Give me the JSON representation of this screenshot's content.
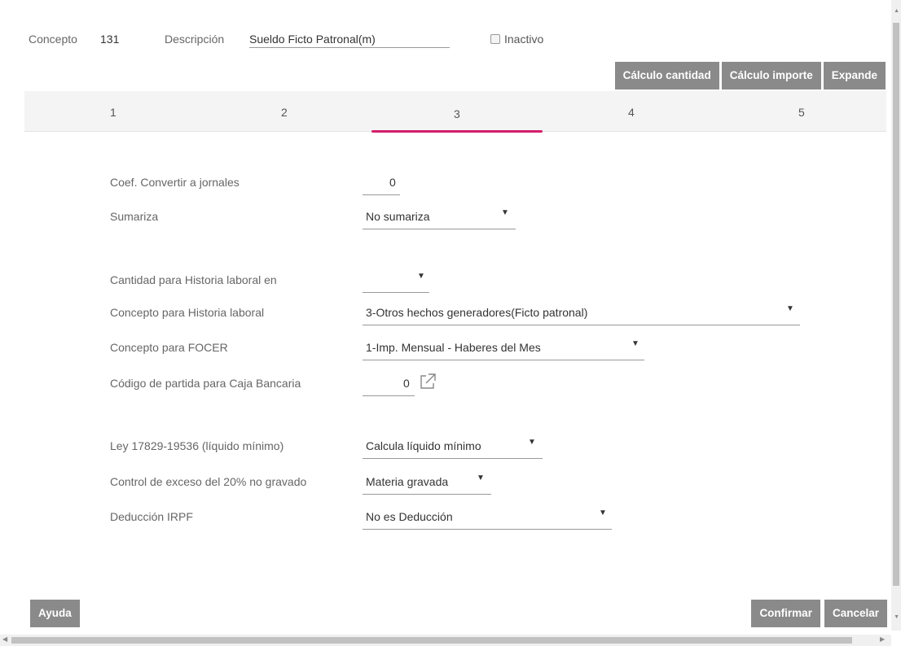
{
  "header": {
    "concepto_label": "Concepto",
    "concepto_value": "131",
    "descripcion_label": "Descripción",
    "descripcion_value": "Sueldo Ficto Patronal(m)",
    "inactivo_label": "Inactivo",
    "inactivo_checked": false
  },
  "toolbar": {
    "calc_cantidad": "Cálculo cantidad",
    "calc_importe": "Cálculo importe",
    "expande": "Expande"
  },
  "tabs": {
    "active": "3",
    "items": [
      {
        "label": "1"
      },
      {
        "label": "2"
      },
      {
        "label": "3"
      },
      {
        "label": "4"
      },
      {
        "label": "5"
      }
    ]
  },
  "form": {
    "coef": {
      "label": "Coef. Convertir a jornales",
      "value": "0"
    },
    "sumariza": {
      "label": "Sumariza",
      "value": "No sumariza"
    },
    "cantidad_historia": {
      "label": "Cantidad para Historia laboral en",
      "value": ""
    },
    "concepto_historia": {
      "label": "Concepto para Historia laboral",
      "value": "3-Otros hechos generadores(Ficto patronal)"
    },
    "concepto_focer": {
      "label": "Concepto para FOCER",
      "value": "1-Imp. Mensual - Haberes del Mes"
    },
    "codigo_partida": {
      "label": "Código de partida para Caja Bancaria",
      "value": "0",
      "icon": "external-link-icon"
    },
    "ley": {
      "label": "Ley 17829-19536 (líquido mínimo)",
      "value": "Calcula líquido mínimo"
    },
    "control_exceso": {
      "label": "Control de exceso del 20% no gravado",
      "value": "Materia gravada"
    },
    "deduccion": {
      "label": "Deducción IRPF",
      "value": "No es Deducción"
    }
  },
  "footer": {
    "ayuda": "Ayuda",
    "confirmar": "Confirmar",
    "cancelar": "Cancelar"
  },
  "colors": {
    "accent": "#d41f6a",
    "button_bg": "#8a8a8a"
  },
  "dropdown_arrow": "▼"
}
